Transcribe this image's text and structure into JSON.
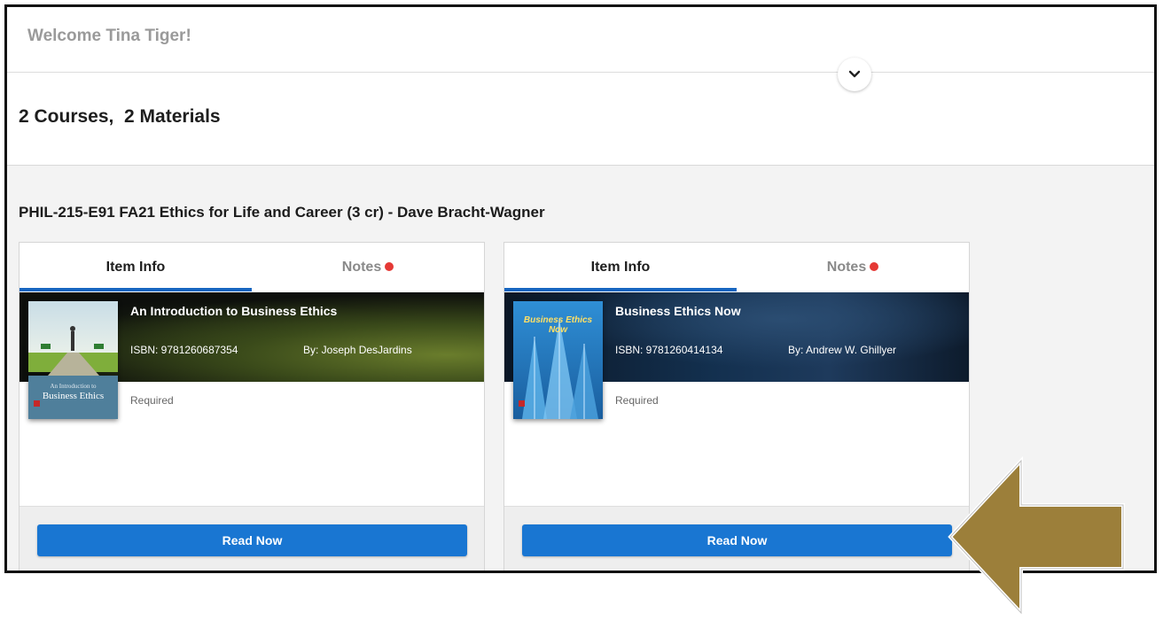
{
  "header": {
    "welcome": "Welcome Tina Tiger!"
  },
  "summary": {
    "text": "2 Courses,  2 Materials"
  },
  "course": {
    "title": "PHIL-215-E91 FA21 Ethics for Life and Career (3 cr) - Dave Bracht-Wagner"
  },
  "cards": [
    {
      "tabs": {
        "info": "Item Info",
        "notes": "Notes"
      },
      "title": "An Introduction to Business Ethics",
      "isbn": "ISBN: 9781260687354",
      "author": "By: Joseph DesJardins",
      "status": "Required",
      "button": "Read Now",
      "cover": {
        "line1": "An Introduction to",
        "line2": "Business Ethics"
      }
    },
    {
      "tabs": {
        "info": "Item Info",
        "notes": "Notes"
      },
      "title": "Business Ethics Now",
      "isbn": "ISBN: 9781260414134",
      "author": "By: Andrew W. Ghillyer",
      "status": "Required",
      "button": "Read Now",
      "cover": {
        "line1": "Business Ethics Now"
      }
    }
  ],
  "colors": {
    "primary_blue": "#1976d2",
    "tab_underline": "#1565c0",
    "notes_dot": "#e53935",
    "arrow": "#9c7f3a"
  },
  "icons": {
    "expand": "chevron-down-icon",
    "pointer": "arrow-left-icon"
  }
}
